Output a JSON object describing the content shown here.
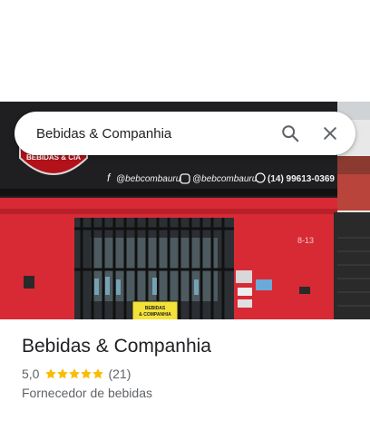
{
  "search": {
    "query": "Bebidas & Companhia"
  },
  "photo": {
    "sign_facebook": "@bebcombauru",
    "sign_instagram": "@bebcombauru",
    "sign_phone": "(14) 99613-0369",
    "logo_text": "BEBIDAS & CIA",
    "house_number": "8-13",
    "banner_line1": "BEBIDAS",
    "banner_line2": "& COMPANHIA"
  },
  "place": {
    "name": "Bebidas & Companhia",
    "rating": "5,0",
    "rating_value": 5,
    "review_count": "(21)",
    "category": "Fornecedor de bebidas"
  },
  "colors": {
    "star": "#fbbc04",
    "wall_red": "#d82a35",
    "sign_black": "#1f1f22"
  },
  "icons": [
    "search-icon",
    "close-icon",
    "facebook-icon",
    "instagram-icon",
    "phone-icon",
    "star-icon"
  ]
}
